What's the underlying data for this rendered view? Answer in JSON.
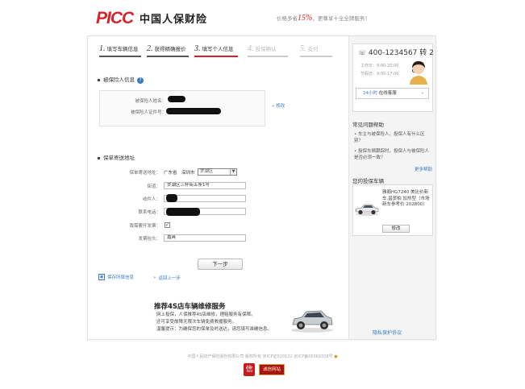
{
  "header": {
    "logo": "PICC",
    "logo_cn": "中国人保财险",
    "slogan_pre": "价格多省",
    "slogan_pct": "15%",
    "slogan_post": "，更尊享十全全牌服务！"
  },
  "steps": [
    {
      "num": "1.",
      "label": "填写车辆信息"
    },
    {
      "num": "2.",
      "label": "获得精确报价"
    },
    {
      "num": "3.",
      "label": "填写个人信息"
    },
    {
      "num": "4.",
      "label": "投保确认"
    },
    {
      "num": "5.",
      "label": "支付"
    }
  ],
  "insured": {
    "title": "被保险人信息",
    "help": "?",
    "name_label": "被保险人姓名：",
    "id_label": "被保险人证件号：",
    "edit": "修改"
  },
  "delivery": {
    "title": "保单寄送地址",
    "address_label": "保单寄送地址：",
    "province": "广东省",
    "city": "深圳市",
    "district": "罗湖区",
    "street_label": "街道：",
    "street_value": "罗湖区三杯街五条1号",
    "recipient_label": "收件人：",
    "phone_label": "联系电话：",
    "invoice_label": "我需要开发票：",
    "invoice_checked": "✓",
    "invoice_title_label": "发票抬头：",
    "invoice_title_value": "嘉爽"
  },
  "actions": {
    "next": "下一步",
    "save": "保存所填信息",
    "back": "返回上一步"
  },
  "promo": {
    "title": "推荐4S店车辆维修服务",
    "line1": "网上投保，人保推荐4S店维修，理赔服务有保障。",
    "line2": "还可享受故障无限次车辆免费救援服务。",
    "line3": "温馨提示：为确保您的保单及时送达，请您填写准确信息。"
  },
  "sidebar": {
    "phone": "400-1234567 转 2",
    "workday": "工作日：9:00-20:00",
    "holiday": "节假日：9:00-17:00",
    "online_pre": "24小时",
    "online": "在线客服",
    "online_arrow": "›",
    "faq_title": "常见问题帮助",
    "faq": [
      "车主与被保险人、投保人有什么区别？",
      "投保车辆跟踪时，投保人与被保险人是否必须一致？"
    ],
    "more": "更多帮助",
    "car_title": "您的投保车辆",
    "car_desc": "雅阁HG7240 美比价新车,昌贺柏 加热型（市场新车参考价 202800）",
    "modify": "修改",
    "privacy": "隐私保护协议"
  },
  "footer": {
    "copyright": "中国人民财产保险股份有限公司 版权所有 京ICP证020122 京ICP备05069338号",
    "badge1": "信",
    "badge2": "诚信网站"
  },
  "colors": {
    "brand_red": "#d8222a",
    "link_blue": "#3a7bbf"
  }
}
